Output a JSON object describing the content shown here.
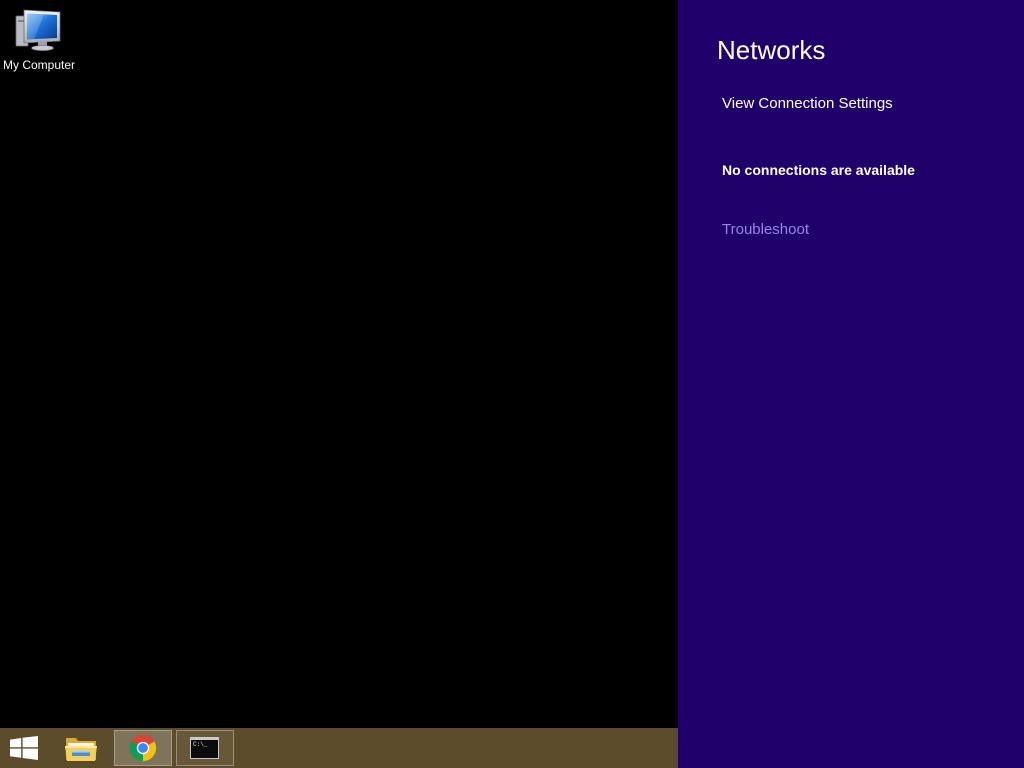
{
  "desktop": {
    "icons": [
      {
        "label": "My Computer",
        "icon": "computer-icon"
      }
    ]
  },
  "taskbar": {
    "items": [
      {
        "icon": "windows-logo-icon",
        "highlighted": false
      },
      {
        "icon": "file-explorer-icon",
        "highlighted": false
      },
      {
        "icon": "chrome-icon",
        "highlighted": true
      },
      {
        "icon": "command-prompt-icon",
        "highlighted": false,
        "prompt_text": "C:\\_"
      }
    ]
  },
  "networks_panel": {
    "title": "Networks",
    "view_settings_label": "View Connection Settings",
    "status": "No connections are available",
    "troubleshoot_label": "Troubleshoot"
  },
  "colors": {
    "desktop": "#000000",
    "taskbar": "#5c4c2b",
    "panel": "#1f0068",
    "panel_text": "#ffffff",
    "link": "#9c82ee"
  }
}
